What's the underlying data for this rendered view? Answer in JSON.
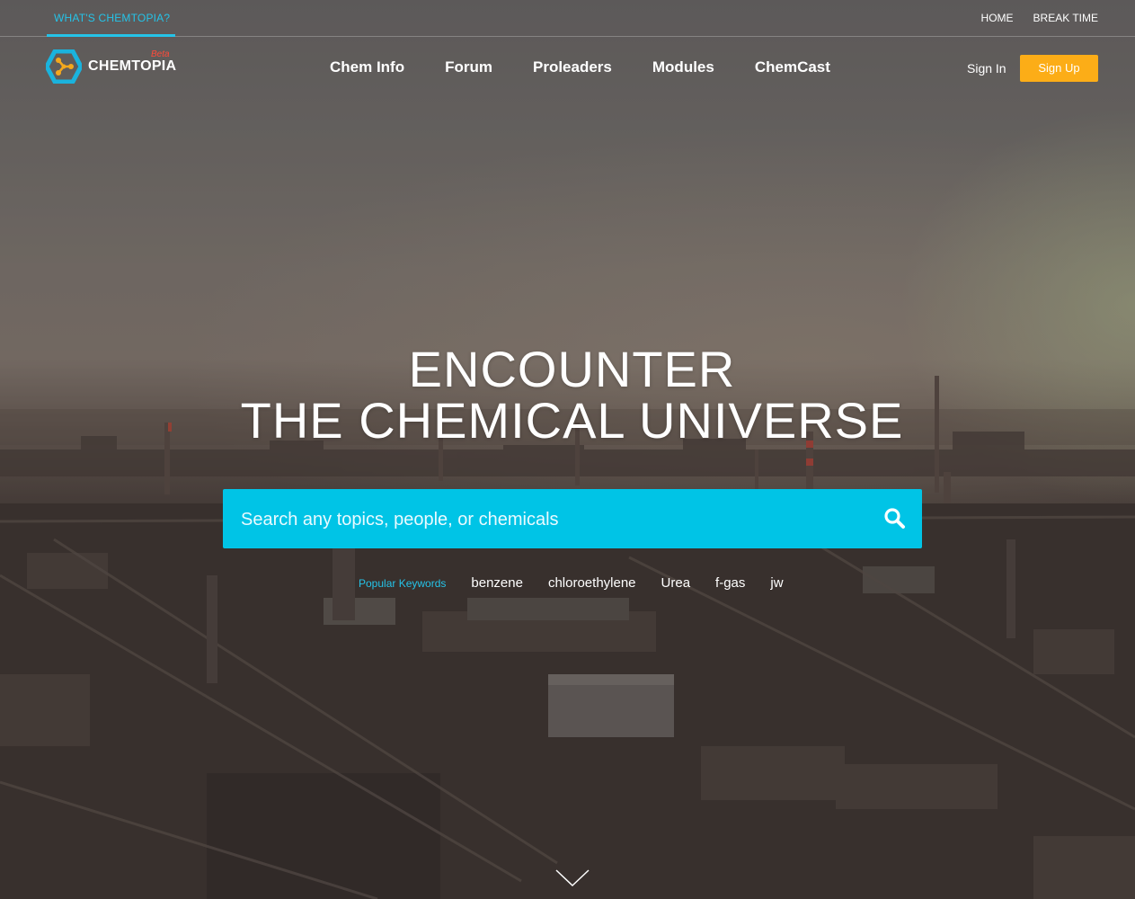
{
  "topbar": {
    "whats_label": "WHAT'S CHEMTOPIA?",
    "links": [
      "HOME",
      "BREAK TIME"
    ]
  },
  "brand": {
    "name": "CHEMTOPIA",
    "badge": "Beta",
    "logo_color": "#1ab3dd",
    "logo_accent": "#f4a81d"
  },
  "nav": {
    "items": [
      "Chem Info",
      "Forum",
      "Proleaders",
      "Modules",
      "ChemCast"
    ],
    "sign_in": "Sign In",
    "sign_up": "Sign Up"
  },
  "hero": {
    "line1": "ENCOUNTER",
    "line2": "THE CHEMICAL UNIVERSE"
  },
  "search": {
    "placeholder": "Search any topics, people, or chemicals",
    "value": "",
    "button_icon": "search-icon"
  },
  "keywords": {
    "label": "Popular Keywords",
    "items": [
      "benzene",
      "chloroethylene",
      "Urea",
      "f-gas",
      "jw"
    ]
  },
  "scroll": {
    "icon": "chevron-down-icon"
  },
  "colors": {
    "accent": "#00c4e6",
    "signup": "#fcad17",
    "highlight": "#25c3e8",
    "beta": "#ff4b3a"
  }
}
